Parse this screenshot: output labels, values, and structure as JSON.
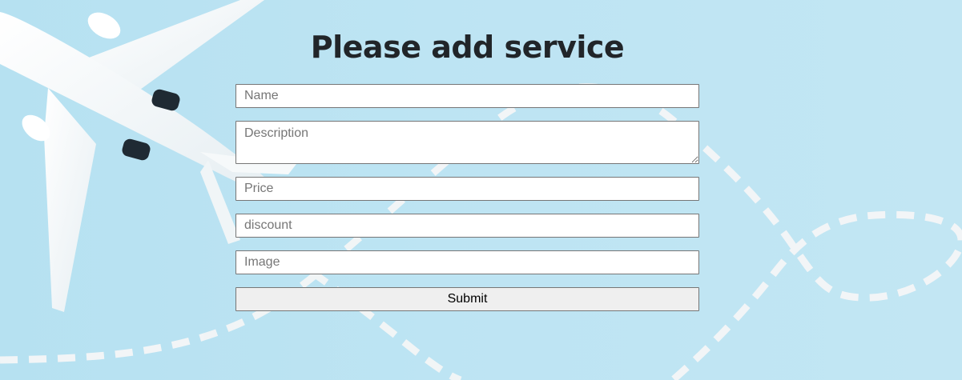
{
  "form": {
    "title": "Please add service",
    "name_placeholder": "Name",
    "description_placeholder": "Description",
    "price_placeholder": "Price",
    "discount_placeholder": "discount",
    "image_placeholder": "Image",
    "submit_label": "Submit"
  },
  "colors": {
    "background": "#b9e3f2",
    "title_text": "#212529",
    "input_border": "#767676",
    "button_bg": "#efefef"
  },
  "icons": {
    "background_illustration": "airplane-with-dashed-flight-path"
  }
}
